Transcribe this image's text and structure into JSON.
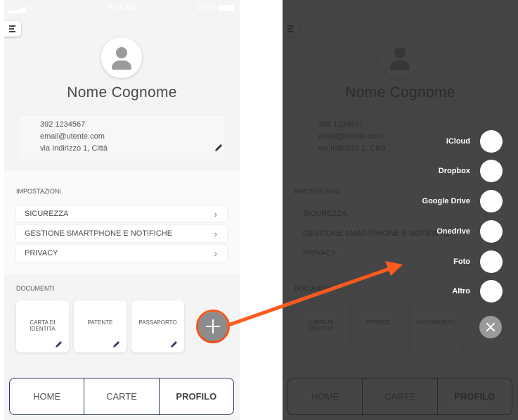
{
  "status_bar": {
    "time": "9:41 AM",
    "battery": "100%"
  },
  "profile": {
    "name": "Nome Cognome",
    "phone": "392 1234567",
    "email": "email@utente.com",
    "address": "via Indirizzo 1, Città"
  },
  "settings": {
    "title": "IMPOSTAZIONI",
    "items": [
      {
        "label": "SICUREZZA"
      },
      {
        "label": "GESTIONE SMARTPHONE E NOTIFICHE"
      },
      {
        "label": "PRIVACY"
      }
    ]
  },
  "documents": {
    "title": "DOCUMENTI",
    "items": [
      {
        "label": "CARTA DI IDENTITA"
      },
      {
        "label": "PATENTE"
      },
      {
        "label": "PASSAPORTO"
      }
    ]
  },
  "tabs": [
    {
      "label": "HOME"
    },
    {
      "label": "CARTE"
    },
    {
      "label": "PROFILO"
    }
  ],
  "upload_sources": [
    {
      "label": "iCloud"
    },
    {
      "label": "Dropbox"
    },
    {
      "label": "Google Drive"
    },
    {
      "label": "Onedrive"
    },
    {
      "label": "Foto"
    },
    {
      "label": "Altro"
    }
  ],
  "colors": {
    "annotation": "#ff5a1f",
    "tab_border": "#2f3a6b",
    "fab": "#8c8c8c"
  }
}
